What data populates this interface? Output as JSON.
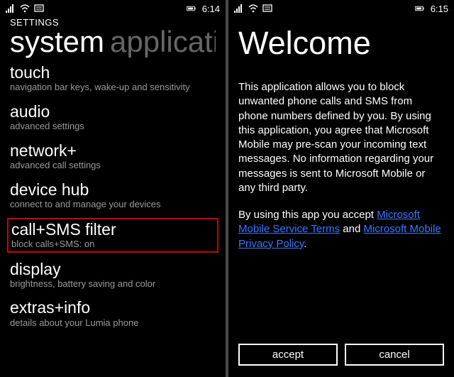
{
  "left": {
    "clock": "6:14",
    "header": "SETTINGS",
    "pivot": {
      "active": "system",
      "inactive": "applications"
    },
    "items": [
      {
        "title": "touch",
        "sub": "navigation bar keys, wake-up and sensitivity"
      },
      {
        "title": "audio",
        "sub": "advanced settings"
      },
      {
        "title": "network+",
        "sub": "advanced call settings"
      },
      {
        "title": "device hub",
        "sub": "connect to and manage your devices"
      },
      {
        "title": "call+SMS filter",
        "sub": "block calls+SMS: on",
        "highlight": true
      },
      {
        "title": "display",
        "sub": "brightness, battery saving and color"
      },
      {
        "title": "extras+info",
        "sub": "details about your Lumia phone"
      }
    ]
  },
  "right": {
    "clock": "6:15",
    "title": "Welcome",
    "body": "This application allows you to block unwanted phone calls and SMS from phone numbers defined by you. By using this application, you agree that Microsoft Mobile may pre-scan your incoming text messages. No information regarding your messages is sent to Microsoft Mobile or any third party.",
    "terms_prefix": "By using this app you accept ",
    "terms_link1": "Microsoft Mobile Service Terms",
    "terms_and": " and ",
    "terms_link2": "Microsoft Mobile Privacy Policy",
    "terms_suffix": ".",
    "accept": "accept",
    "cancel": "cancel"
  }
}
